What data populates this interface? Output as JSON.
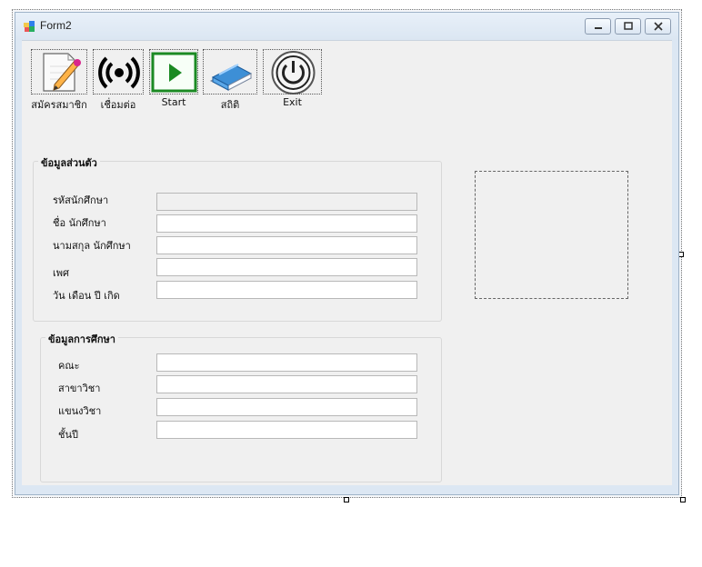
{
  "window": {
    "title": "Form2"
  },
  "toolbar": {
    "buttons": [
      {
        "label": "สมัครสมาชิก",
        "icon": "register-edit-icon"
      },
      {
        "label": "เชื่อมต่อ",
        "icon": "connect-signal-icon"
      },
      {
        "label": "Start",
        "icon": "play-icon"
      },
      {
        "label": "สถิติ",
        "icon": "book-icon"
      },
      {
        "label": "Exit",
        "icon": "power-icon"
      }
    ]
  },
  "personal_group": {
    "title": "ข้อมูลส่วนตัว",
    "fields": [
      {
        "label": "รหัสนักศึกษา",
        "value": "",
        "readonly": true
      },
      {
        "label": "ชื่อ นักศึกษา",
        "value": ""
      },
      {
        "label": "นามสกุล นักศึกษา",
        "value": ""
      },
      {
        "label": "เพศ",
        "value": ""
      },
      {
        "label": "วัน เดือน ปี เกิด",
        "value": ""
      }
    ]
  },
  "education_group": {
    "title": "ข้อมูลการศึกษา",
    "fields": [
      {
        "label": "คณะ",
        "value": ""
      },
      {
        "label": "สาขาวิชา",
        "value": ""
      },
      {
        "label": "แขนงวิชา",
        "value": ""
      },
      {
        "label": "ชั้นปี",
        "value": ""
      }
    ]
  },
  "colors": {
    "titlebar": "#dbe6f2",
    "client": "#f0f0f0",
    "play_green": "#1b8a23"
  }
}
